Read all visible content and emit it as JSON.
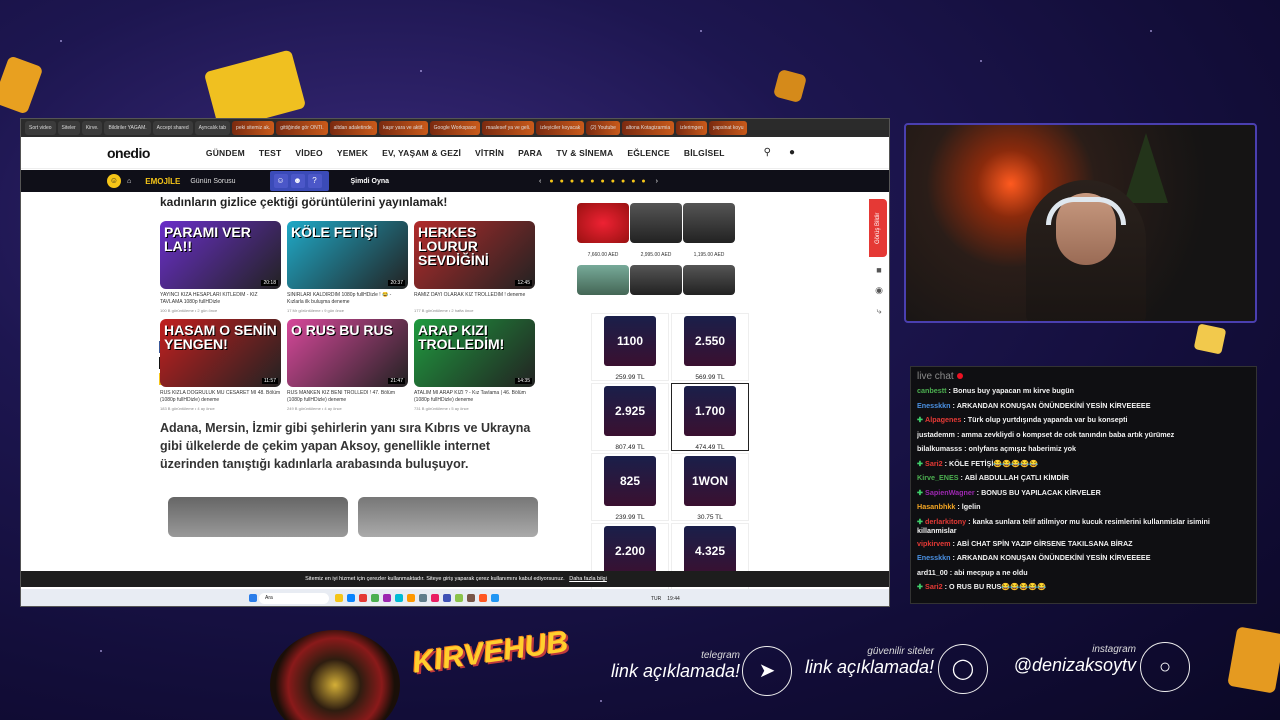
{
  "browser": {
    "tabs": [
      "Sort video",
      "Siteler",
      "Kirve.",
      "Bildiriler YAGAM.",
      "Accept shared",
      "Ayrıcalık tab",
      "peki sitemiz ak.",
      "gittiğinde gör ONTI.",
      "altdan adaletinde.",
      "kaşır yara ve aktif.",
      "Google Workspace",
      "maalesef ya ve geli.",
      "izleyiciler koyacak",
      "(2) Youtube",
      "altona Kotagizarmia",
      "izlerimgen",
      "yapsinat koyu"
    ],
    "site": {
      "logo": "onedio",
      "nav": [
        "GÜNDEM",
        "TEST",
        "VİDEO",
        "YEMEK",
        "EV, YAŞAM & GEZİ",
        "VİTRİN",
        "PARA",
        "TV & SİNEMA",
        "EĞLENCE",
        "BİLGİSEL"
      ],
      "search_icon": "search-icon",
      "user_icon": "user-icon",
      "subbar": {
        "brand": "EMOJİLE",
        "gunun": "Günün Sorusu",
        "simdi": "Şimdi Oyna"
      },
      "article": {
        "heading": "kadınların gizlice çektiği görüntülerini yayınlamak!",
        "videos": [
          {
            "overlay": "PARAMI VER LA!!",
            "title": "YAYINCI KIZA HESAPLARI KİTLEDİM - KIZ TAVLAMA 1080p fullHDizle",
            "meta": "100 B görüntüleme • 2 gün önce",
            "duration": "20:18",
            "color": "#6a2fc9"
          },
          {
            "overlay": "KÖLE FETİŞİ",
            "title": "SINIRLARI KALDIRDIM 1080p fullHDizle ! 😂 - Kızlarla ilk buluşma deneme",
            "meta": "17 Mr görüntüleme • 9 gün önce",
            "duration": "20:37",
            "color": "#1fa9c7"
          },
          {
            "overlay": "HERKES LOURUR SEVDİĞİNİ",
            "title": "RAMİZ DAYI OLARAK KIZ TROLLEDİM ! deneme",
            "meta": "177 B görüntüleme • 2 hafta önce",
            "duration": "12:45",
            "color": "#b22b2b"
          },
          {
            "overlay": "HASAM O SENİN YENGEN!",
            "title": "RUS KIZLA DOĞRULUK MU CESARET Mİ 48. Bölüm (1080p fullHDizle) deneme",
            "meta": "183 B görüntüleme • 4 ay önce",
            "duration": "11:57",
            "color": "#c21f1f"
          },
          {
            "overlay": "O RUS BU RUS",
            "title": "RUS MANKEN KIZ BENİ TROLLEDİ ! 47. Bölüm (1080p fullHDizle) deneme",
            "meta": "249 B görüntüleme • 4 ay önce",
            "duration": "21:47",
            "color": "#d6489a"
          },
          {
            "overlay": "ARAP KIZI TROLLEDİM!",
            "title": "ATALIM MI ARAP KIZI ? - Kız Tavlama | 46. Bölüm (1080p fullHDizle) deneme",
            "meta": "731 B görüntüleme • 5 ay önce",
            "duration": "14:35",
            "color": "#1f9a3f"
          }
        ],
        "paragraph": "Adana, Mersin, İzmir gibi şehirlerin yanı sıra Kıbrıs ve Ukrayna gibi ülkelerde de çekim yapan Aksoy, genellikle internet üzerinden tanıştığı kadınlarla arabasında buluşuyor."
      },
      "ads": {
        "grills": [
          "7,660.00 AED",
          "2,995.00 AED",
          "1,195.00 AED"
        ]
      },
      "products": [
        {
          "img": "1100",
          "price": "259.99 TL"
        },
        {
          "img": "2.550",
          "price": "569.99 TL"
        },
        {
          "img": "2.925",
          "price": "807.49 TL"
        },
        {
          "img": "1.700",
          "price": "474.49 TL",
          "selected": true
        },
        {
          "img": "825",
          "price": "239.99 TL"
        },
        {
          "img": "1WON",
          "price": "30.75 TL"
        },
        {
          "img": "2.200",
          "price": ""
        },
        {
          "img": "4.325",
          "price": ""
        }
      ],
      "gorus": "Görüş Bildir",
      "cookie": {
        "text": "Sitemiz en iyi hizmet için çerezler kullanmaktadır. Siteye giriş yaparak çerez kullanımını kabul ediyorsunuz.",
        "link": "Daha fazla bilgi"
      }
    },
    "taskbar": {
      "search": "Ara",
      "lang": "TUR",
      "time": "19:44"
    }
  },
  "chat": {
    "title": "live chat",
    "messages": [
      {
        "user": "canbestt",
        "color": "#4caf50",
        "text": "Bonus buy yapacan mı kirve bugün"
      },
      {
        "user": "Enesskkn",
        "color": "#4a90e2",
        "text": "ARKANDAN KONUŞAN ÖNÜNDEKİNİ YESİN KİRVEEEEE"
      },
      {
        "user": "Alpagenes",
        "color": "#e53935",
        "text": "Türk olup yurtdışında yapanda var bu konsepti",
        "heart": true
      },
      {
        "user": "justademm",
        "color": "#f2f2f2",
        "text": "amma zevkliydi o kompset de cok tanındın baba artık yürümez"
      },
      {
        "user": "bilalkumasss",
        "color": "#f2f2f2",
        "text": "onlyfans açmışız haberimiz yok"
      },
      {
        "user": "Sari2",
        "color": "#e53935",
        "text": "KÖLE FETİŞİ😂😂😂😂😂",
        "heart": true
      },
      {
        "user": "Kirve_ENES",
        "color": "#4caf50",
        "text": "ABİ ABDULLAH ÇATLI KİMDİR"
      },
      {
        "user": "SapienWagner",
        "color": "#9c27b0",
        "text": "BONUS BU YAPILACAK KİRVELER",
        "heart": true
      },
      {
        "user": "Hasanbhkk",
        "color": "#f5a623",
        "text": "lgelin"
      },
      {
        "user": "derlarkitony",
        "color": "#e53935",
        "text": "kanka sunlara telif atilmiyor mu kucuk resimlerini kullanmislar isimini killanmislar",
        "heart": true,
        "wrap": true
      },
      {
        "user": "vipkirvem",
        "color": "#e53935",
        "text": "ABİ CHAT SPİN YAZIP GİRSENE TAKILSANA BİRAZ"
      },
      {
        "user": "Enesskkn",
        "color": "#4a90e2",
        "text": "ARKANDAN KONUŞAN ÖNÜNDEKİNİ YESİN KİRVEEEEE"
      },
      {
        "user": "ard11_00",
        "color": "#f2f2f2",
        "text": "abi mecpup a ne oldu"
      },
      {
        "user": "Sari2",
        "color": "#e53935",
        "text": "O RUS BU RUS😂😂😂😂😂",
        "heart": true
      }
    ]
  },
  "overlay": {
    "brand": "KIRVEHUB",
    "telegram": {
      "label": "telegram",
      "text": "link açıklamada!"
    },
    "sites": {
      "label": "güvenilir siteler",
      "text": "link açıklamada!"
    },
    "instagram": {
      "label": "instagram",
      "text": "@denizaksoytv"
    }
  }
}
